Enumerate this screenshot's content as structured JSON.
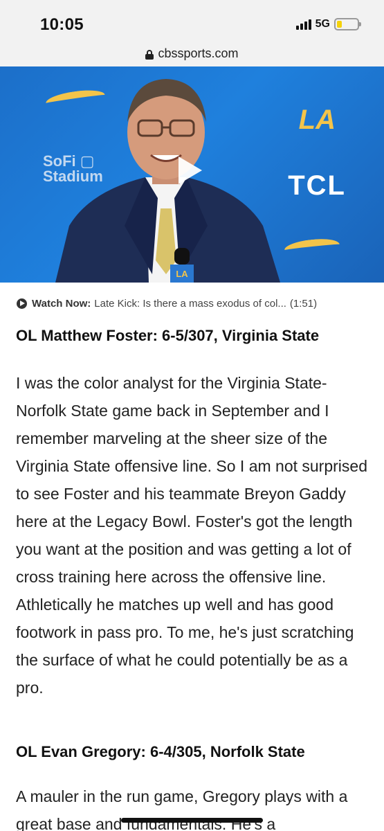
{
  "status_bar": {
    "time": "10:05",
    "network": "5G",
    "battery_level": 0.25,
    "battery_color": "#f5d20a"
  },
  "browser": {
    "url": "cbssports.com",
    "icon": "lock-icon"
  },
  "video": {
    "icon": "play-icon",
    "backdrop_colors": {
      "blue": "#1f80dd",
      "gold": "#f3c44a"
    },
    "backdrop_text": {
      "venue": "SoFi Stadium",
      "team": "LA",
      "sponsor": "TCL",
      "mic_flag": "LA"
    }
  },
  "watch_now": {
    "label": "Watch Now:",
    "title": "Late Kick: Is there a mass exodus of col...",
    "duration": "(1:51)",
    "icon": "play-circle-icon"
  },
  "article": {
    "sections": [
      {
        "heading": "OL Matthew Foster: 6-5/307, Virginia State",
        "body": "I was the color analyst for the Virginia State-Norfolk State game back in September and I remember marveling at the sheer size of the Virginia State offensive line. So I am not surprised to see Foster and his teammate Breyon Gaddy here at the Legacy Bowl. Foster's got the length you want at the position and was getting a lot of cross training here across the offensive line. Athletically he matches up well and has good footwork in pass pro. To me, he's just scratching the surface of what he could potentially be as a pro."
      },
      {
        "heading": "OL Evan Gregory: 6-4/305, Norfolk State",
        "body": "A mauler in the run game, Gregory plays with a great base and fundamentals. He's a"
      }
    ]
  }
}
